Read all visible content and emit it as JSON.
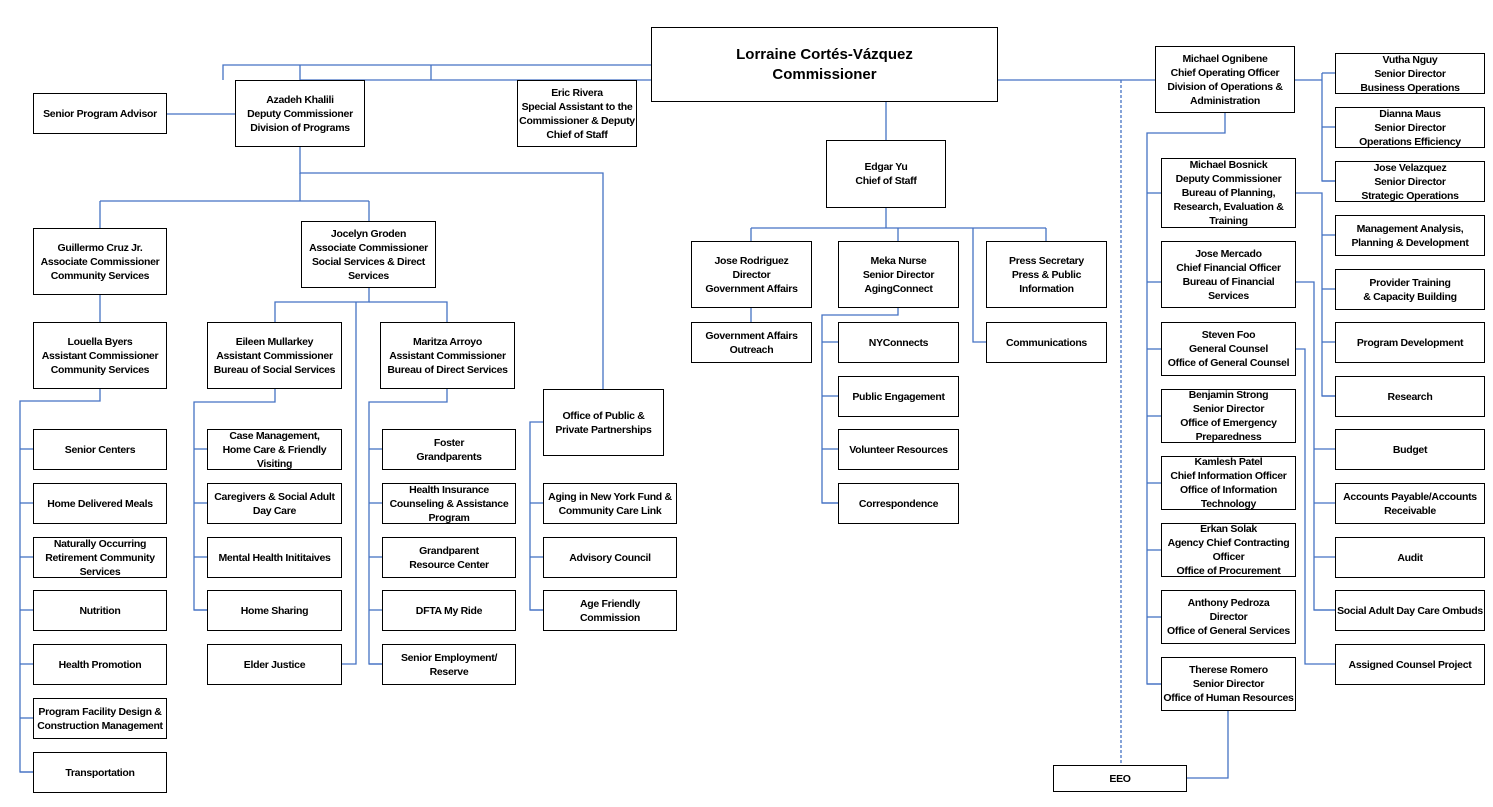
{
  "chart_data": {
    "type": "org-chart",
    "title": "",
    "root": "commissioner",
    "nodes": {
      "commissioner": {
        "text": "Lorraine Cortés-Vázquez\nCommissioner"
      },
      "khalili": {
        "text": "Azadeh Khalili\nDeputy Commissioner\nDivision of Programs"
      },
      "senior_program_advisor": {
        "text": "Senior Program Advisor"
      },
      "rivera": {
        "text": "Eric Rivera\nSpecial Assistant to the\nCommissioner & Deputy\nChief of Staff"
      },
      "yu": {
        "text": "Edgar Yu\nChief of Staff"
      },
      "ognibene": {
        "text": "Michael Ognibene\nChief Operating Officer\nDivision of Operations &\nAdministration"
      },
      "cruz": {
        "text": "Guillermo Cruz Jr.\nAssociate Commissioner\nCommunity Services"
      },
      "groden": {
        "text": "Jocelyn Groden\nAssociate Commissioner\nSocial Services & Direct\nServices"
      },
      "byers": {
        "text": "Louella Byers\nAssistant Commissioner\nCommunity Services"
      },
      "mullarkey": {
        "text": "Eileen Mullarkey\nAssistant Commissioner\nBureau of Social Services"
      },
      "arroyo": {
        "text": "Maritza Arroyo\nAssistant Commissioner\nBureau of Direct Services"
      },
      "ppp": {
        "text": "Office of Public &\nPrivate Partnerships"
      },
      "senior_centers": {
        "text": "Senior Centers"
      },
      "home_delivered_meals": {
        "text": "Home Delivered Meals"
      },
      "norc": {
        "text": "Naturally Occurring\nRetirement Community\nServices"
      },
      "nutrition": {
        "text": "Nutrition"
      },
      "health_promotion": {
        "text": "Health Promotion"
      },
      "facility_design": {
        "text": "Program Facility Design &\nConstruction Management"
      },
      "transportation": {
        "text": "Transportation"
      },
      "case_management": {
        "text": "Case Management,\nHome Care & Friendly\nVisiting"
      },
      "caregivers": {
        "text": "Caregivers & Social Adult\nDay Care"
      },
      "mental_health": {
        "text": "Mental Health Inititaives"
      },
      "home_sharing": {
        "text": "Home Sharing"
      },
      "elder_justice": {
        "text": "Elder Justice"
      },
      "foster_grandparents": {
        "text": "Foster\nGrandparents"
      },
      "hiicap": {
        "text": "Health Insurance\nCounseling & Assistance\nProgram"
      },
      "grandparent_resource": {
        "text": "Grandparent\nResource Center"
      },
      "my_ride": {
        "text": "DFTA My Ride"
      },
      "senior_employment": {
        "text": "Senior Employment/\nReserve"
      },
      "aging_ny_fund": {
        "text": "Aging in New York Fund &\nCommunity Care Link"
      },
      "advisory_council": {
        "text": "Advisory Council"
      },
      "age_friendly": {
        "text": "Age Friendly\nCommission"
      },
      "rodriguez": {
        "text": "Jose Rodriguez\nDirector\nGovernment Affairs"
      },
      "nurse": {
        "text": "Meka Nurse\nSenior Director\nAgingConnect"
      },
      "press": {
        "text": "Press Secretary\nPress & Public\nInformation"
      },
      "gov_outreach": {
        "text": "Government Affairs\nOutreach"
      },
      "nyconnects": {
        "text": "NYConnects"
      },
      "public_engagement": {
        "text": "Public Engagement"
      },
      "volunteer": {
        "text": "Volunteer Resources"
      },
      "correspondence": {
        "text": "Correspondence"
      },
      "communications": {
        "text": "Communications"
      },
      "nguy": {
        "text": "Vutha Nguy\nSenior Director\nBusiness Operations"
      },
      "maus": {
        "text": "Dianna Maus\nSenior Director\nOperations Efficiency"
      },
      "velazquez": {
        "text": "Jose Velazquez\nSenior Director\nStrategic Operations"
      },
      "bosnick": {
        "text": "Michael Bosnick\nDeputy Commissioner\nBureau of Planning,\nResearch, Evaluation &\nTraining"
      },
      "mercado": {
        "text": "Jose Mercado\nChief Financial Officer\nBureau of Financial\nServices"
      },
      "foo": {
        "text": "Steven Foo\nGeneral Counsel\nOffice of General Counsel"
      },
      "strong": {
        "text": "Benjamin Strong\nSenior Director\nOffice of Emergency\nPreparedness"
      },
      "patel": {
        "text": "Kamlesh Patel\nChief Information Officer\nOffice of Information\nTechnology"
      },
      "solak": {
        "text": "Erkan Solak\nAgency Chief Contracting\nOfficer\nOffice of Procurement"
      },
      "pedroza": {
        "text": "Anthony Pedroza\nDirector\nOffice of General Services"
      },
      "romero": {
        "text": "Therese Romero\nSenior Director\nOffice of Human Resources"
      },
      "eeo": {
        "text": "EEO"
      },
      "mgmt_analysis": {
        "text": "Management Analysis,\nPlanning & Development"
      },
      "provider_training": {
        "text": "Provider Training\n& Capacity Building"
      },
      "program_development": {
        "text": "Program Development"
      },
      "research": {
        "text": "Research"
      },
      "budget": {
        "text": "Budget"
      },
      "ap_ar": {
        "text": "Accounts Payable/Accounts\nReceivable"
      },
      "audit": {
        "text": "Audit"
      },
      "sadc_ombuds": {
        "text": "Social Adult Day Care Ombuds"
      },
      "assigned_counsel": {
        "text": "Assigned Counsel Project"
      }
    },
    "edges": [
      [
        "commissioner",
        "khalili"
      ],
      [
        "commissioner",
        "rivera"
      ],
      [
        "commissioner",
        "yu"
      ],
      [
        "commissioner",
        "ognibene"
      ],
      [
        "khalili",
        "senior_program_advisor"
      ],
      [
        "khalili",
        "cruz"
      ],
      [
        "khalili",
        "groden"
      ],
      [
        "khalili",
        "ppp"
      ],
      [
        "cruz",
        "byers"
      ],
      [
        "byers",
        "senior_centers"
      ],
      [
        "byers",
        "home_delivered_meals"
      ],
      [
        "byers",
        "norc"
      ],
      [
        "byers",
        "nutrition"
      ],
      [
        "byers",
        "health_promotion"
      ],
      [
        "byers",
        "facility_design"
      ],
      [
        "byers",
        "transportation"
      ],
      [
        "groden",
        "mullarkey"
      ],
      [
        "groden",
        "arroyo"
      ],
      [
        "groden",
        "elder_justice"
      ],
      [
        "mullarkey",
        "case_management"
      ],
      [
        "mullarkey",
        "caregivers"
      ],
      [
        "mullarkey",
        "mental_health"
      ],
      [
        "mullarkey",
        "home_sharing"
      ],
      [
        "arroyo",
        "foster_grandparents"
      ],
      [
        "arroyo",
        "hiicap"
      ],
      [
        "arroyo",
        "grandparent_resource"
      ],
      [
        "arroyo",
        "my_ride"
      ],
      [
        "arroyo",
        "senior_employment"
      ],
      [
        "ppp",
        "aging_ny_fund"
      ],
      [
        "ppp",
        "advisory_council"
      ],
      [
        "ppp",
        "age_friendly"
      ],
      [
        "yu",
        "rodriguez"
      ],
      [
        "yu",
        "nurse"
      ],
      [
        "yu",
        "press"
      ],
      [
        "yu",
        "communications"
      ],
      [
        "rodriguez",
        "gov_outreach"
      ],
      [
        "nurse",
        "nyconnects"
      ],
      [
        "nurse",
        "public_engagement"
      ],
      [
        "nurse",
        "volunteer"
      ],
      [
        "nurse",
        "correspondence"
      ],
      [
        "ognibene",
        "nguy"
      ],
      [
        "ognibene",
        "maus"
      ],
      [
        "ognibene",
        "velazquez"
      ],
      [
        "ognibene",
        "bosnick"
      ],
      [
        "ognibene",
        "mercado"
      ],
      [
        "ognibene",
        "foo"
      ],
      [
        "ognibene",
        "strong"
      ],
      [
        "ognibene",
        "patel"
      ],
      [
        "ognibene",
        "solak"
      ],
      [
        "ognibene",
        "pedroza"
      ],
      [
        "ognibene",
        "romero"
      ],
      [
        "bosnick",
        "mgmt_analysis"
      ],
      [
        "bosnick",
        "provider_training"
      ],
      [
        "bosnick",
        "program_development"
      ],
      [
        "bosnick",
        "research"
      ],
      [
        "mercado",
        "budget"
      ],
      [
        "mercado",
        "ap_ar"
      ],
      [
        "mercado",
        "audit"
      ],
      [
        "mercado",
        "sadc_ombuds"
      ],
      [
        "foo",
        "assigned_counsel"
      ],
      [
        "romero",
        "eeo"
      ]
    ],
    "dotted_edges": [
      [
        "commissioner",
        "eeo"
      ]
    ],
    "colors": {
      "connector": "#4472c4",
      "box_border": "#000000",
      "text": "#000000"
    }
  }
}
